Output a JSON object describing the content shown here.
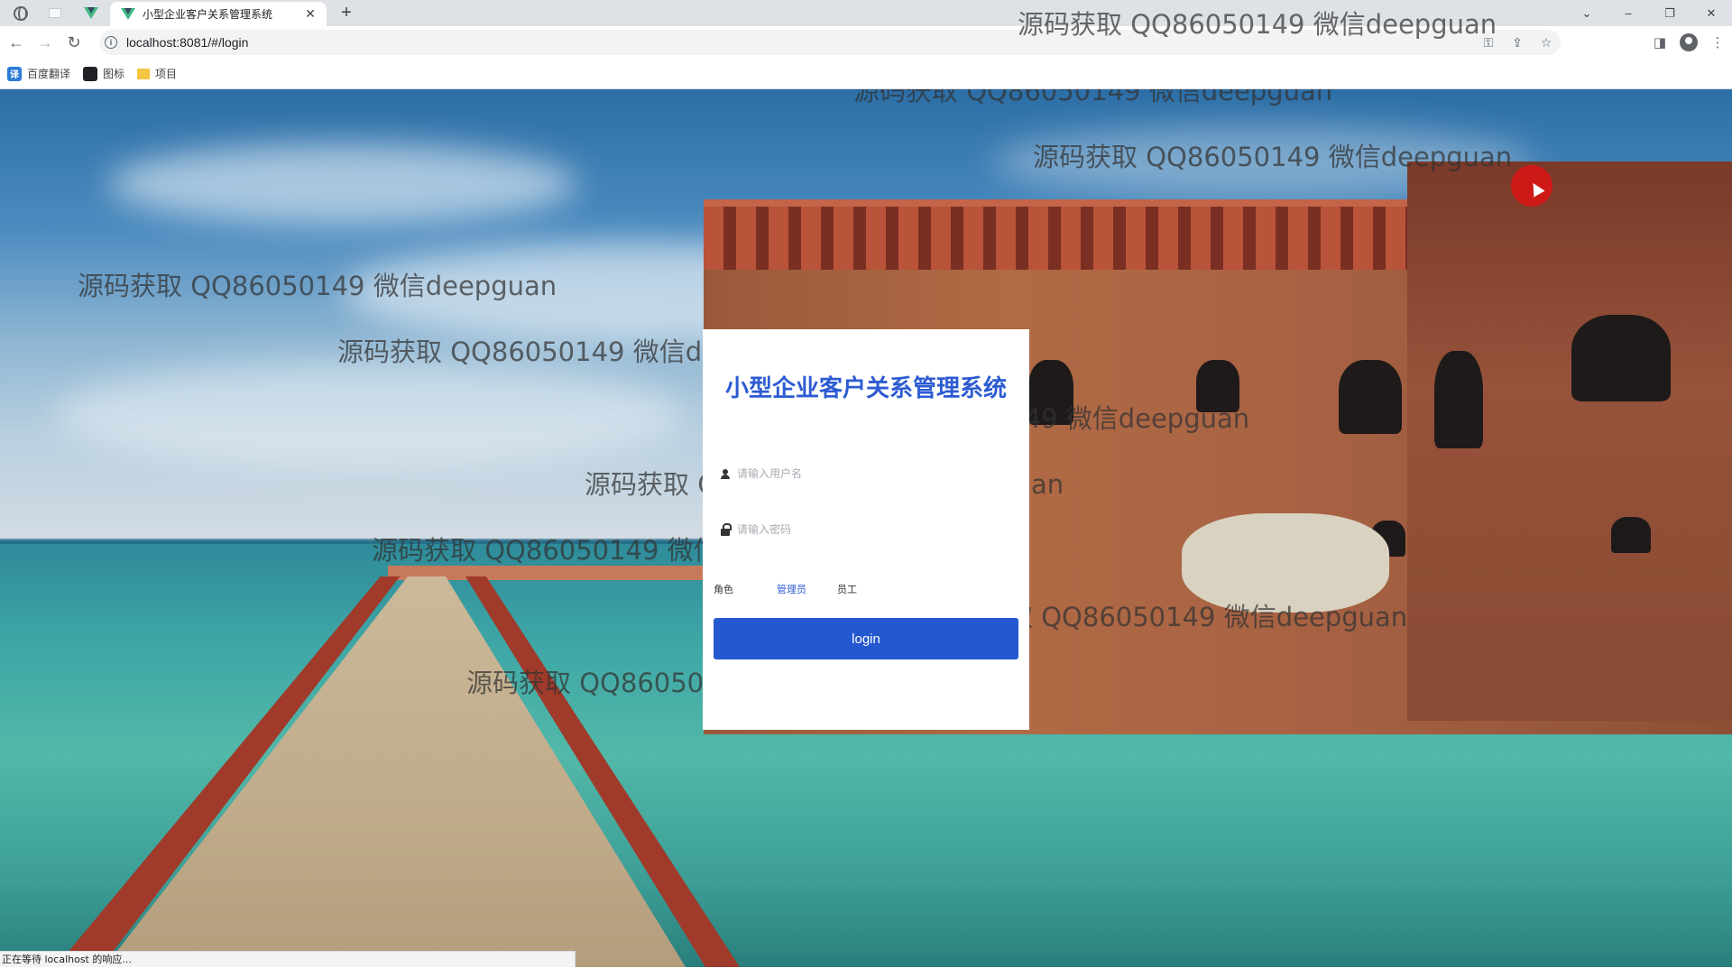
{
  "browser": {
    "tab_title": "小型企业客户关系管理系统",
    "tab_close": "✕",
    "new_tab": "+",
    "url": "localhost:8081/#/login",
    "window_controls": [
      "⌄",
      "–",
      "❐",
      "✕"
    ],
    "bookmarks": [
      {
        "label": "百度翻译",
        "icon": "translate-icon"
      },
      {
        "label": "图标",
        "icon": "icon-library-icon"
      },
      {
        "label": "项目",
        "icon": "folder-icon"
      }
    ],
    "status_text": "正在等待 localhost 的响应..."
  },
  "watermark_text": "源码获取 QQ86050149 微信deepguan",
  "login": {
    "title": "小型企业客户关系管理系统",
    "username_placeholder": "请输入用户名",
    "password_placeholder": "请输入密码",
    "role_label": "角色",
    "role_options": [
      "管理员",
      "员工"
    ],
    "role_selected": "管理员",
    "button_label": "login"
  },
  "colors": {
    "accent": "#2458cf",
    "title": "#2d5bd2"
  }
}
